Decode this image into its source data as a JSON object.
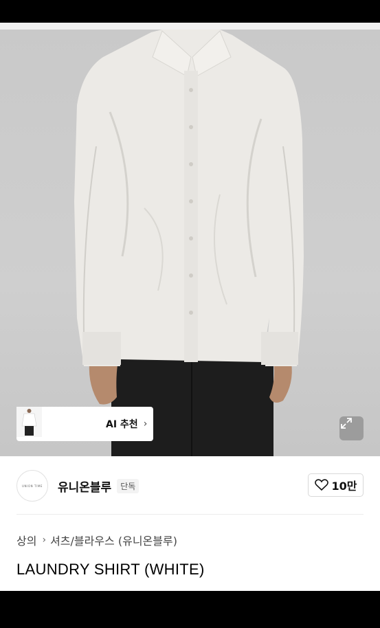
{
  "product": {
    "image_alt": "LAUNDRY SHIRT (WHITE) product photo",
    "thumbnails": [
      {
        "icon": "shirt-front-thumb"
      },
      {
        "icon": "shirt-model-thumb"
      },
      {
        "icon": "shirt-full-thumb"
      }
    ],
    "ai_recommend_label": "AI 추천",
    "expand_icon": "expand-icon",
    "brand": {
      "name": "유니온블루",
      "badge": "단독",
      "logo_text": "UNION TIME"
    },
    "likes": "10만",
    "breadcrumb": {
      "level1": "상의",
      "level2": "셔츠/블라우스 (유니온블루)"
    },
    "title": "LAUNDRY SHIRT (WHITE)"
  },
  "colors": {
    "background_hero": "#cbcbcb",
    "shirt": "#eceae6",
    "pants": "#1d1d1d",
    "text_primary": "#111111"
  }
}
